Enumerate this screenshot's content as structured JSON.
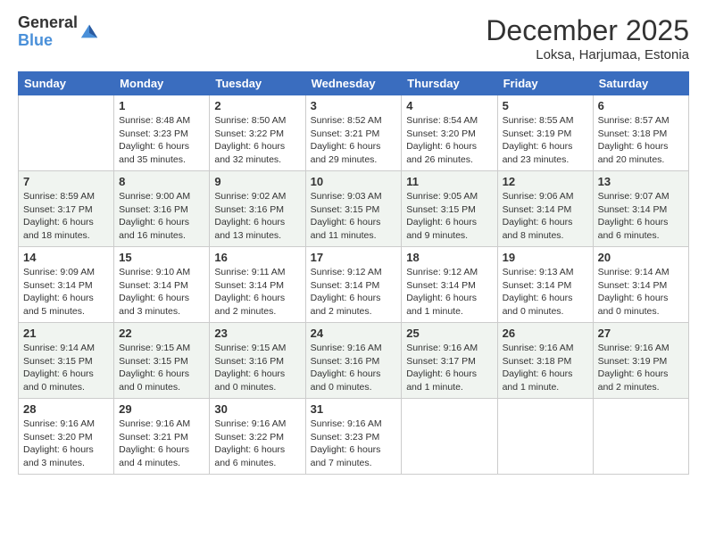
{
  "header": {
    "logo_line1": "General",
    "logo_line2": "Blue",
    "month": "December 2025",
    "location": "Loksa, Harjumaa, Estonia"
  },
  "days_of_week": [
    "Sunday",
    "Monday",
    "Tuesday",
    "Wednesday",
    "Thursday",
    "Friday",
    "Saturday"
  ],
  "weeks": [
    [
      {
        "day": "",
        "info": ""
      },
      {
        "day": "1",
        "info": "Sunrise: 8:48 AM\nSunset: 3:23 PM\nDaylight: 6 hours\nand 35 minutes."
      },
      {
        "day": "2",
        "info": "Sunrise: 8:50 AM\nSunset: 3:22 PM\nDaylight: 6 hours\nand 32 minutes."
      },
      {
        "day": "3",
        "info": "Sunrise: 8:52 AM\nSunset: 3:21 PM\nDaylight: 6 hours\nand 29 minutes."
      },
      {
        "day": "4",
        "info": "Sunrise: 8:54 AM\nSunset: 3:20 PM\nDaylight: 6 hours\nand 26 minutes."
      },
      {
        "day": "5",
        "info": "Sunrise: 8:55 AM\nSunset: 3:19 PM\nDaylight: 6 hours\nand 23 minutes."
      },
      {
        "day": "6",
        "info": "Sunrise: 8:57 AM\nSunset: 3:18 PM\nDaylight: 6 hours\nand 20 minutes."
      }
    ],
    [
      {
        "day": "7",
        "info": "Sunrise: 8:59 AM\nSunset: 3:17 PM\nDaylight: 6 hours\nand 18 minutes."
      },
      {
        "day": "8",
        "info": "Sunrise: 9:00 AM\nSunset: 3:16 PM\nDaylight: 6 hours\nand 16 minutes."
      },
      {
        "day": "9",
        "info": "Sunrise: 9:02 AM\nSunset: 3:16 PM\nDaylight: 6 hours\nand 13 minutes."
      },
      {
        "day": "10",
        "info": "Sunrise: 9:03 AM\nSunset: 3:15 PM\nDaylight: 6 hours\nand 11 minutes."
      },
      {
        "day": "11",
        "info": "Sunrise: 9:05 AM\nSunset: 3:15 PM\nDaylight: 6 hours\nand 9 minutes."
      },
      {
        "day": "12",
        "info": "Sunrise: 9:06 AM\nSunset: 3:14 PM\nDaylight: 6 hours\nand 8 minutes."
      },
      {
        "day": "13",
        "info": "Sunrise: 9:07 AM\nSunset: 3:14 PM\nDaylight: 6 hours\nand 6 minutes."
      }
    ],
    [
      {
        "day": "14",
        "info": "Sunrise: 9:09 AM\nSunset: 3:14 PM\nDaylight: 6 hours\nand 5 minutes."
      },
      {
        "day": "15",
        "info": "Sunrise: 9:10 AM\nSunset: 3:14 PM\nDaylight: 6 hours\nand 3 minutes."
      },
      {
        "day": "16",
        "info": "Sunrise: 9:11 AM\nSunset: 3:14 PM\nDaylight: 6 hours\nand 2 minutes."
      },
      {
        "day": "17",
        "info": "Sunrise: 9:12 AM\nSunset: 3:14 PM\nDaylight: 6 hours\nand 2 minutes."
      },
      {
        "day": "18",
        "info": "Sunrise: 9:12 AM\nSunset: 3:14 PM\nDaylight: 6 hours\nand 1 minute."
      },
      {
        "day": "19",
        "info": "Sunrise: 9:13 AM\nSunset: 3:14 PM\nDaylight: 6 hours\nand 0 minutes."
      },
      {
        "day": "20",
        "info": "Sunrise: 9:14 AM\nSunset: 3:14 PM\nDaylight: 6 hours\nand 0 minutes."
      }
    ],
    [
      {
        "day": "21",
        "info": "Sunrise: 9:14 AM\nSunset: 3:15 PM\nDaylight: 6 hours\nand 0 minutes."
      },
      {
        "day": "22",
        "info": "Sunrise: 9:15 AM\nSunset: 3:15 PM\nDaylight: 6 hours\nand 0 minutes."
      },
      {
        "day": "23",
        "info": "Sunrise: 9:15 AM\nSunset: 3:16 PM\nDaylight: 6 hours\nand 0 minutes."
      },
      {
        "day": "24",
        "info": "Sunrise: 9:16 AM\nSunset: 3:16 PM\nDaylight: 6 hours\nand 0 minutes."
      },
      {
        "day": "25",
        "info": "Sunrise: 9:16 AM\nSunset: 3:17 PM\nDaylight: 6 hours\nand 1 minute."
      },
      {
        "day": "26",
        "info": "Sunrise: 9:16 AM\nSunset: 3:18 PM\nDaylight: 6 hours\nand 1 minute."
      },
      {
        "day": "27",
        "info": "Sunrise: 9:16 AM\nSunset: 3:19 PM\nDaylight: 6 hours\nand 2 minutes."
      }
    ],
    [
      {
        "day": "28",
        "info": "Sunrise: 9:16 AM\nSunset: 3:20 PM\nDaylight: 6 hours\nand 3 minutes."
      },
      {
        "day": "29",
        "info": "Sunrise: 9:16 AM\nSunset: 3:21 PM\nDaylight: 6 hours\nand 4 minutes."
      },
      {
        "day": "30",
        "info": "Sunrise: 9:16 AM\nSunset: 3:22 PM\nDaylight: 6 hours\nand 6 minutes."
      },
      {
        "day": "31",
        "info": "Sunrise: 9:16 AM\nSunset: 3:23 PM\nDaylight: 6 hours\nand 7 minutes."
      },
      {
        "day": "",
        "info": ""
      },
      {
        "day": "",
        "info": ""
      },
      {
        "day": "",
        "info": ""
      }
    ]
  ]
}
